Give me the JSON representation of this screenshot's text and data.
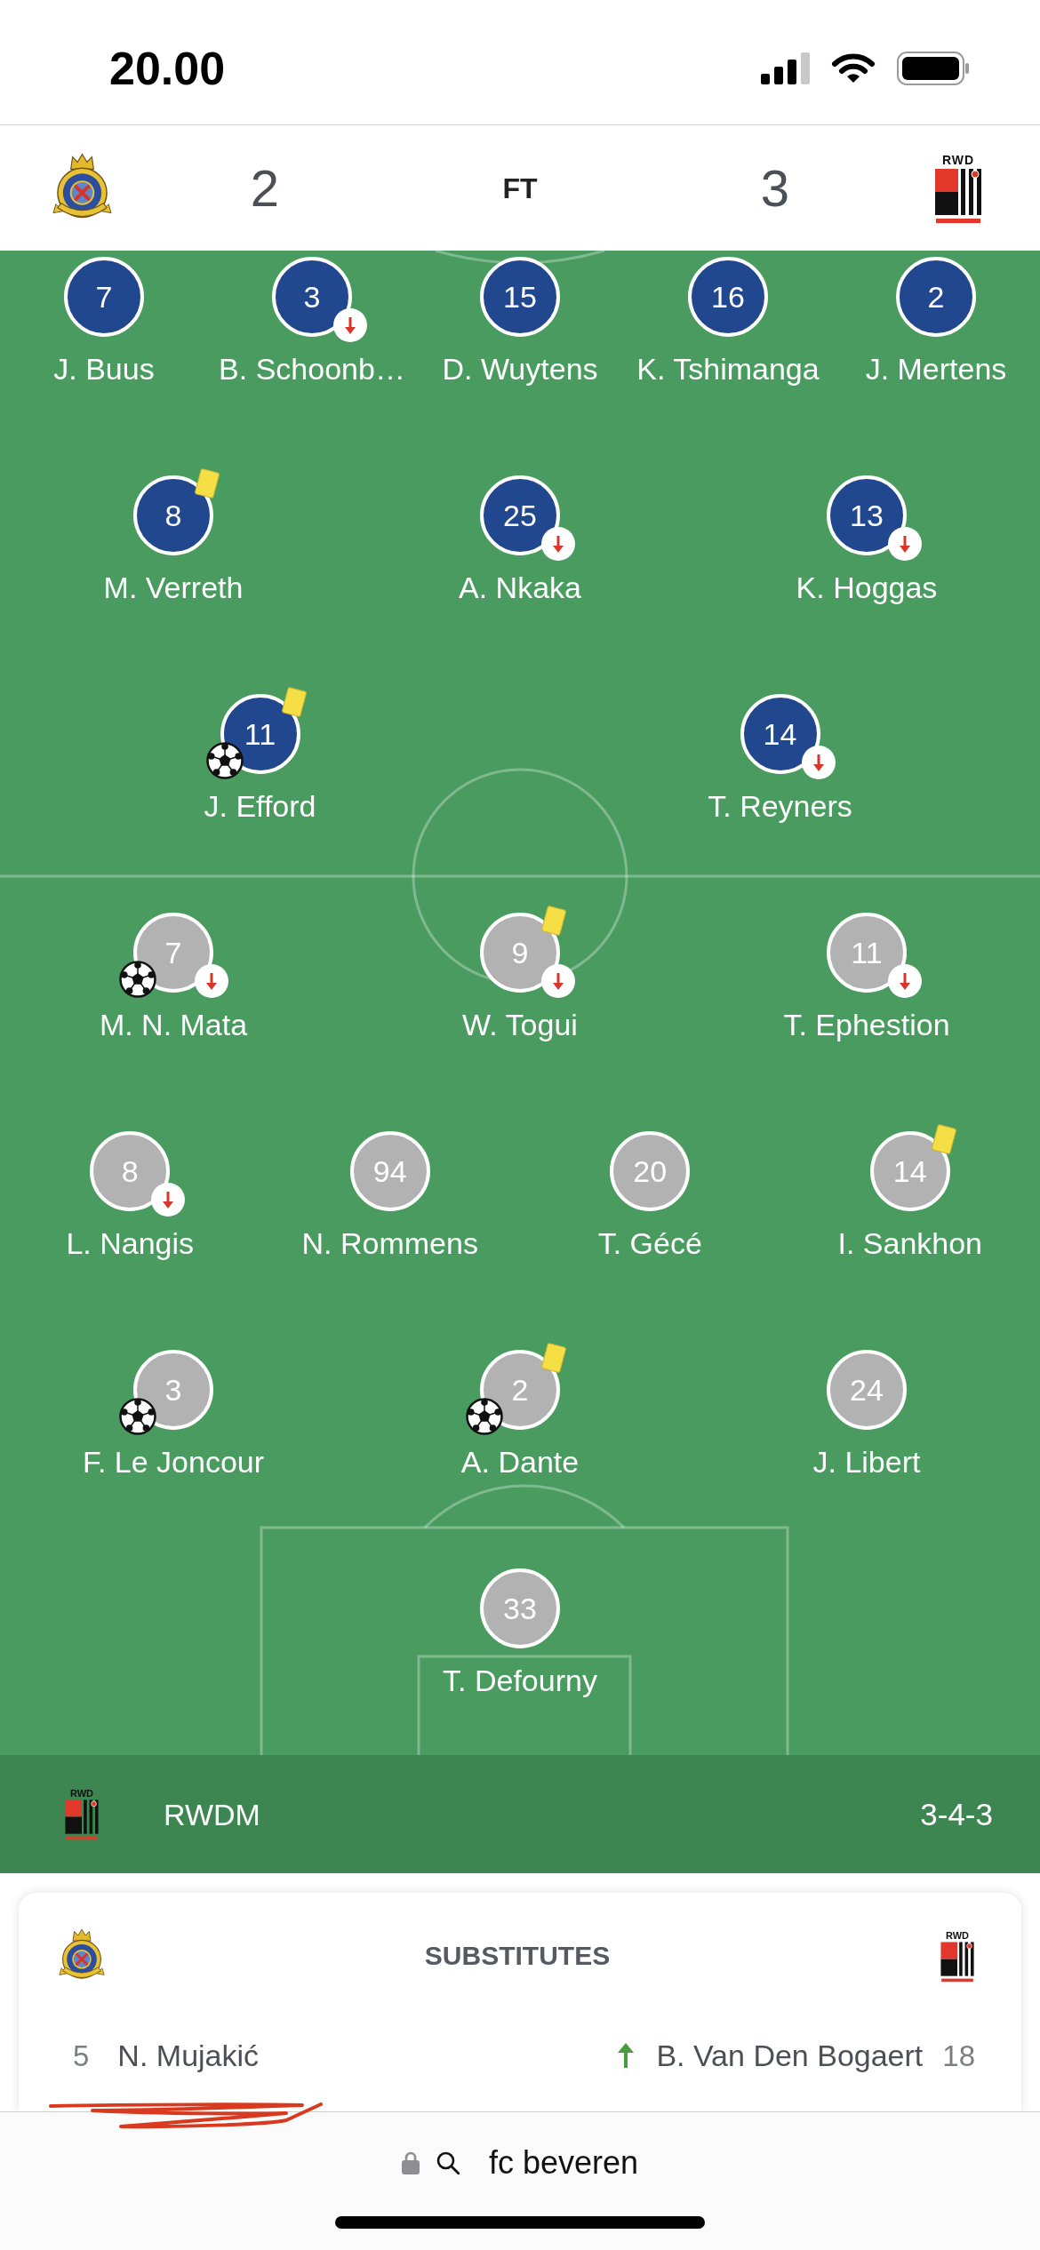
{
  "status_bar": {
    "time": "20.00"
  },
  "match_header": {
    "home_score": "2",
    "status": "FT",
    "away_score": "3",
    "away_logo_text": "RWD"
  },
  "lineups": [
    {
      "kind": "home",
      "rows": [
        {
          "players": [
            {
              "number": "7",
              "name": "J. Buus",
              "subbed_off": false,
              "yellow_card": false,
              "scored": false
            },
            {
              "number": "3",
              "name": "B. Schoonb…",
              "subbed_off": true,
              "yellow_card": false,
              "scored": false
            },
            {
              "number": "15",
              "name": "D. Wuytens",
              "subbed_off": false,
              "yellow_card": false,
              "scored": false
            },
            {
              "number": "16",
              "name": "K. Tshimanga",
              "subbed_off": false,
              "yellow_card": false,
              "scored": false
            },
            {
              "number": "2",
              "name": "J. Mertens",
              "subbed_off": false,
              "yellow_card": false,
              "scored": false
            }
          ]
        },
        {
          "players": [
            {
              "number": "8",
              "name": "M. Verreth",
              "subbed_off": false,
              "yellow_card": true,
              "scored": false
            },
            {
              "number": "25",
              "name": "A. Nkaka",
              "subbed_off": true,
              "yellow_card": false,
              "scored": false
            },
            {
              "number": "13",
              "name": "K. Hoggas",
              "subbed_off": true,
              "yellow_card": false,
              "scored": false
            }
          ]
        },
        {
          "players": [
            {
              "number": "11",
              "name": "J. Efford",
              "subbed_off": false,
              "yellow_card": true,
              "scored": true
            },
            {
              "number": "14",
              "name": "T. Reyners",
              "subbed_off": true,
              "yellow_card": false,
              "scored": false
            }
          ]
        }
      ]
    },
    {
      "kind": "away",
      "rows": [
        {
          "players": [
            {
              "number": "7",
              "name": "M. N. Mata",
              "subbed_off": true,
              "yellow_card": false,
              "scored": true
            },
            {
              "number": "9",
              "name": "W. Togui",
              "subbed_off": true,
              "yellow_card": true,
              "scored": false
            },
            {
              "number": "11",
              "name": "T. Ephestion",
              "subbed_off": true,
              "yellow_card": false,
              "scored": false
            }
          ]
        },
        {
          "players": [
            {
              "number": "8",
              "name": "L. Nangis",
              "subbed_off": true,
              "yellow_card": false,
              "scored": false
            },
            {
              "number": "94",
              "name": "N. Rommens",
              "subbed_off": false,
              "yellow_card": false,
              "scored": false
            },
            {
              "number": "20",
              "name": "T. Gécé",
              "subbed_off": false,
              "yellow_card": false,
              "scored": false
            },
            {
              "number": "14",
              "name": "I. Sankhon",
              "subbed_off": false,
              "yellow_card": true,
              "scored": false
            }
          ]
        },
        {
          "players": [
            {
              "number": "3",
              "name": "F. Le Joncour",
              "subbed_off": false,
              "yellow_card": false,
              "scored": true
            },
            {
              "number": "2",
              "name": "A. Dante",
              "subbed_off": false,
              "yellow_card": true,
              "scored": true
            },
            {
              "number": "24",
              "name": "J. Libert",
              "subbed_off": false,
              "yellow_card": false,
              "scored": false
            }
          ]
        },
        {
          "players": [
            {
              "number": "33",
              "name": "T. Defourny",
              "subbed_off": false,
              "yellow_card": false,
              "scored": false
            }
          ]
        }
      ]
    }
  ],
  "team_bar": {
    "logo_text": "RWD",
    "team": "RWDM",
    "formation": "3-4-3"
  },
  "substitutes": {
    "title": "SUBSTITUTES",
    "away_logo_text": "RWD",
    "rows": [
      {
        "home_number": "5",
        "home_name": "N. Mujakić",
        "home_subbed_on": false,
        "away_subbed_on": true,
        "away_name": "B. Van Den Bogaert",
        "away_number": "18"
      }
    ]
  },
  "browser_bar": {
    "address": "fc beveren"
  }
}
